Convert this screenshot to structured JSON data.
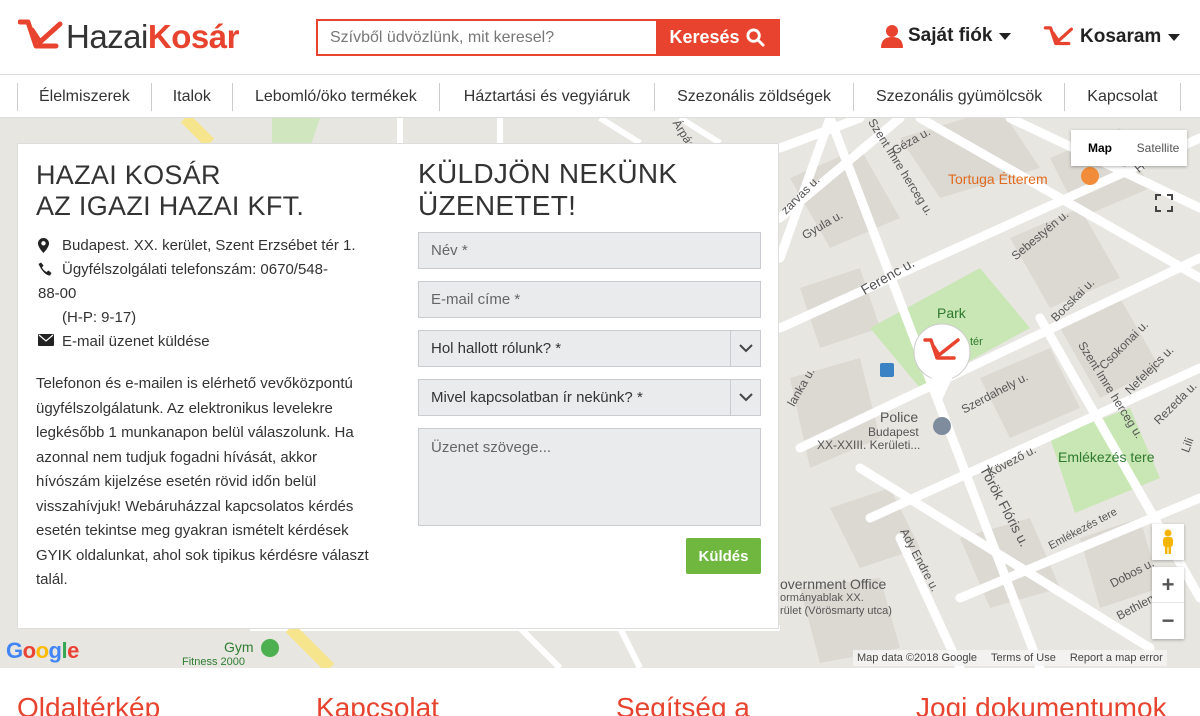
{
  "header": {
    "logo": {
      "part1": "Hazai",
      "part2": "Kosár"
    },
    "search": {
      "placeholder": "Szívből üdvözlünk, mit keresel?",
      "button_label": "Keresés"
    },
    "account_label": "Saját fiók",
    "cart_label": "Kosaram"
  },
  "nav": {
    "items": [
      {
        "label": "Élelmiszerek"
      },
      {
        "label": "Italok"
      },
      {
        "label": "Lebomló/öko termékek"
      },
      {
        "label": "Háztartási és vegyiáruk"
      },
      {
        "label": "Szezonális zöldségek"
      },
      {
        "label": "Szezonális gyümölcsök"
      },
      {
        "label": "Kapcsolat"
      }
    ]
  },
  "contact": {
    "title_line1": "HAZAI KOSÁR",
    "title_line2": "AZ IGAZI HAZAI KFT.",
    "address": "Budapest. XX. kerület, Szent Erzsébet tér 1.",
    "phone_line1": "Ügyfélszolgálati telefonszám: 0670/548-",
    "phone_line2": "88-00",
    "hours": "(H-P: 9-17)",
    "email_label": "E-mail üzenet küldése",
    "description": "Telefonon és e-mailen is elérhető vevőközpontú ügyfélszolgálatunk. Az elektronikus levelekre legkésőbb 1 munkanapon belül válaszolunk. Ha azonnal nem tudjuk fogadni hívását, akkor hívószám kijelzése esetén rövid időn belül visszahívjuk! Webáruházzal kapcsolatos kérdés esetén tekintse meg gyakran ismételt kérdések GYIK oldalunkat, ahol sok tipikus kérdésre választ talál."
  },
  "form": {
    "title_line1": "KÜLDJÖN NEKÜNK",
    "title_line2": "ÜZENETET!",
    "name_placeholder": "Név *",
    "email_placeholder": "E-mail címe *",
    "source_select": "Hol hallott rólunk? *",
    "reason_select": "Mivel kapcsolatban ír nekünk? *",
    "message_placeholder": "Üzenet szövege...",
    "submit_label": "Küldés"
  },
  "map": {
    "type_map": "Map",
    "type_satellite": "Satellite",
    "labels": {
      "restaurant": "Tortuga Étterem",
      "park": "Park",
      "police": "Police",
      "police_sub1": "Budapest",
      "police_sub2": "XX-XXIII. Kerületi...",
      "memorial": "Emlékezés tere",
      "gov": "overnment Office",
      "gov_sub1": "ormányablak XX.",
      "gov_sub2": "rület (Vörösmarty utca)",
      "gym": "Gym",
      "gym_sub": "Fitness 2000",
      "ferenc": "Ferenc u.",
      "torok": "Török Flóris u.",
      "szerdahely": "Szerdahely u.",
      "kovezo": "Kövező u.",
      "emlekezes_street": "Emlékezés tere",
      "szent_imre_top": "Szent Imre herceg u.",
      "szent_imre_right": "Szent Imre herceg u.",
      "gyula": "Gyula u.",
      "geza": "Géza u.",
      "hosszu": "Hosszú u.",
      "sebestyen": "Sebestyén u.",
      "bocskai": "Bocskai u.",
      "csokonai": "Csokonai u.",
      "nefelejcs": "Nefelejcs u.",
      "rezeda": "Rezeda u.",
      "dobos": "Dobos u.",
      "bethlen": "Bethlen",
      "ady": "Ady Endre u.",
      "arpad": "Árpád u.",
      "zarvas": "zarvas u.",
      "lanka": "lanka u.",
      "ter_frag": "tér",
      "lil": "Lili"
    },
    "attribution": {
      "data": "Map data ©2018 Google",
      "terms": "Terms of Use",
      "report": "Report a map error"
    },
    "google": [
      "G",
      "o",
      "o",
      "g",
      "l",
      "e"
    ]
  },
  "footer": {
    "col1": "Oldaltérkép",
    "col2": "Kapcsolat",
    "col3": "Segítség a",
    "col4": "Jogi dokumentumok"
  },
  "colors": {
    "brand": "#e8432e",
    "send": "#6fb73f"
  }
}
